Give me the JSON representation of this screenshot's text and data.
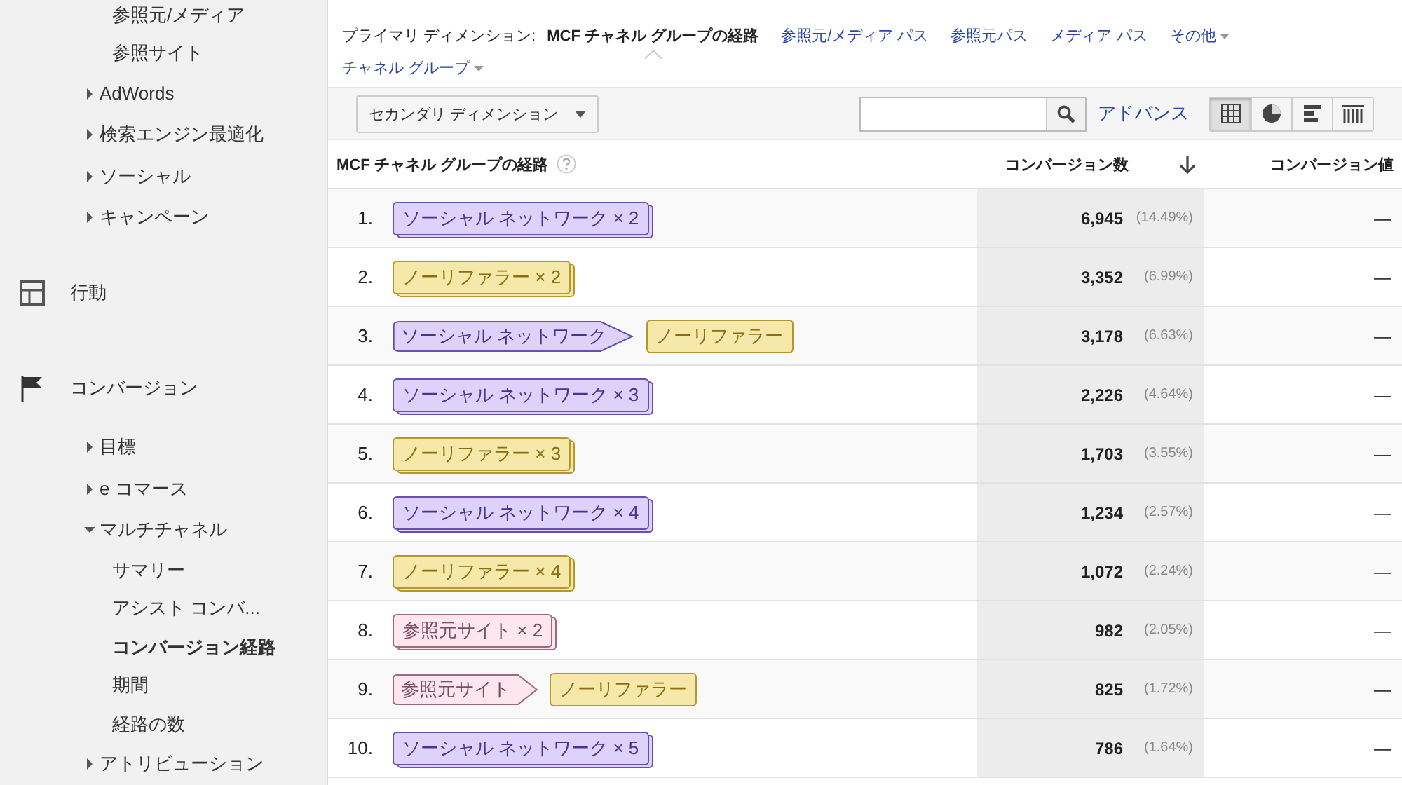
{
  "sidebar": {
    "sections": [
      {
        "items": [
          {
            "children": [
              {
                "label": "参照元/メディア",
                "selected": false
              },
              {
                "label": "参照サイト",
                "selected": false
              }
            ]
          },
          {
            "label": "AdWords",
            "expanded": false
          },
          {
            "label": "検索エンジン最適化",
            "expanded": false
          },
          {
            "label": "ソーシャル",
            "expanded": false
          },
          {
            "label": "キャンペーン",
            "expanded": false
          }
        ]
      },
      {
        "kind": "behavior",
        "label": "行動"
      },
      {
        "kind": "conversion",
        "label": "コンバージョン",
        "items": [
          {
            "label": "目標",
            "expanded": false
          },
          {
            "label": "e コマース",
            "expanded": false
          },
          {
            "label": "マルチチャネル",
            "expanded": true,
            "children": [
              {
                "label": "サマリー",
                "selected": false
              },
              {
                "label": "アシスト コンバ...",
                "selected": false
              },
              {
                "label": "コンバージョン経路",
                "selected": true
              },
              {
                "label": "期間",
                "selected": false
              },
              {
                "label": "経路の数",
                "selected": false
              }
            ]
          },
          {
            "label": "アトリビューション",
            "expanded": false
          }
        ]
      }
    ]
  },
  "primary_dimension": {
    "label": "プライマリ ディメンション:",
    "options": [
      {
        "label": "MCF チャネル グループの経路",
        "selected": true,
        "dropdown": false
      },
      {
        "label": "参照元/メディア パス",
        "selected": false,
        "dropdown": false
      },
      {
        "label": "参照元パス",
        "selected": false,
        "dropdown": false
      },
      {
        "label": "メディア パス",
        "selected": false,
        "dropdown": false
      },
      {
        "label": "その他",
        "selected": false,
        "dropdown": true
      },
      {
        "label": "チャネル グループ",
        "selected": false,
        "dropdown": true
      }
    ]
  },
  "toolbar": {
    "secondary_dimension": "セカンダリ ディメンション",
    "advanced_link": "アドバンス",
    "views": [
      {
        "kind": "table",
        "selected": true
      },
      {
        "kind": "pie",
        "selected": false
      },
      {
        "kind": "bar",
        "selected": false
      },
      {
        "kind": "pivot",
        "selected": false
      }
    ]
  },
  "table": {
    "columns": [
      {
        "label": "MCF チャネル グループの経路",
        "help": true,
        "sorted": false
      },
      {
        "label": "コンバージョン数",
        "help": false,
        "sorted": true
      },
      {
        "label": "コンバージョン値",
        "help": false,
        "sorted": false
      }
    ],
    "rows": [
      {
        "index": "1.",
        "path": [
          {
            "label": "ソーシャル ネットワーク × 2",
            "kind": "social",
            "stacked": true
          }
        ],
        "conversions": "6,945",
        "share": "(14.49%)",
        "value": "—"
      },
      {
        "index": "2.",
        "path": [
          {
            "label": "ノーリファラー × 2",
            "kind": "direct",
            "stacked": true
          }
        ],
        "conversions": "3,352",
        "share": "(6.99%)",
        "value": "—"
      },
      {
        "index": "3.",
        "path": [
          {
            "label": "ソーシャル ネットワーク",
            "kind": "social",
            "stacked": false
          },
          {
            "label": "ノーリファラー",
            "kind": "direct",
            "stacked": false
          }
        ],
        "conversions": "3,178",
        "share": "(6.63%)",
        "value": "—"
      },
      {
        "index": "4.",
        "path": [
          {
            "label": "ソーシャル ネットワーク × 3",
            "kind": "social",
            "stacked": true
          }
        ],
        "conversions": "2,226",
        "share": "(4.64%)",
        "value": "—"
      },
      {
        "index": "5.",
        "path": [
          {
            "label": "ノーリファラー × 3",
            "kind": "direct",
            "stacked": true
          }
        ],
        "conversions": "1,703",
        "share": "(3.55%)",
        "value": "—"
      },
      {
        "index": "6.",
        "path": [
          {
            "label": "ソーシャル ネットワーク × 4",
            "kind": "social",
            "stacked": true
          }
        ],
        "conversions": "1,234",
        "share": "(2.57%)",
        "value": "—"
      },
      {
        "index": "7.",
        "path": [
          {
            "label": "ノーリファラー × 4",
            "kind": "direct",
            "stacked": true
          }
        ],
        "conversions": "1,072",
        "share": "(2.24%)",
        "value": "—"
      },
      {
        "index": "8.",
        "path": [
          {
            "label": "参照元サイト × 2",
            "kind": "referral",
            "stacked": true
          }
        ],
        "conversions": "982",
        "share": "(2.05%)",
        "value": "—"
      },
      {
        "index": "9.",
        "path": [
          {
            "label": "参照元サイト",
            "kind": "referral",
            "stacked": false
          },
          {
            "label": "ノーリファラー",
            "kind": "direct",
            "stacked": false
          }
        ],
        "conversions": "825",
        "share": "(1.72%)",
        "value": "—"
      },
      {
        "index": "10.",
        "path": [
          {
            "label": "ソーシャル ネットワーク × 5",
            "kind": "social",
            "stacked": true
          }
        ],
        "conversions": "786",
        "share": "(1.64%)",
        "value": "—"
      }
    ]
  }
}
